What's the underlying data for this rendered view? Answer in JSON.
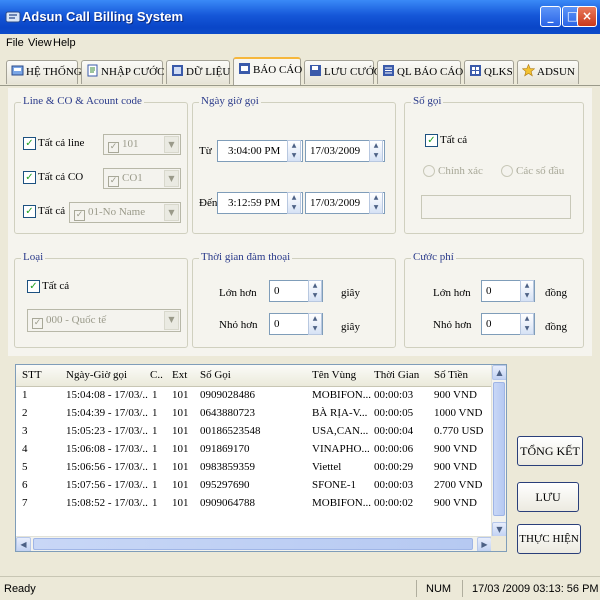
{
  "window": {
    "title": "Adsun Call Billing System"
  },
  "menu": {
    "file": "File",
    "view": "View",
    "help": "Help"
  },
  "tabs": [
    {
      "label": "HỆ THỐNG",
      "icon": "system-icon",
      "color": "#4a7ad8"
    },
    {
      "label": "NHẬP CƯỚC",
      "icon": "import-icon",
      "color": "#3a8a3a"
    },
    {
      "label": "DỮ LIỆU",
      "icon": "database-icon",
      "color": "#3a5aaa"
    },
    {
      "label": "BÁO CÁO",
      "icon": "report-icon",
      "color": "#3a5aaa"
    },
    {
      "label": "LƯU CƯỚC",
      "icon": "save-icon",
      "color": "#3a5aaa"
    },
    {
      "label": "QL BÁO CÁO",
      "icon": "report-manager-icon",
      "color": "#3a5aaa"
    },
    {
      "label": "QLKS",
      "icon": "hotel-icon",
      "color": "#3a5aaa"
    },
    {
      "label": "ADSUN",
      "icon": "adsun-star-icon",
      "color": "#e8b020"
    }
  ],
  "line_group": {
    "title": "Line & CO & Acount code",
    "all_line_label": "Tất cả line",
    "line_value": "101",
    "all_co_label": "Tất cả CO",
    "co_value": "CO1",
    "all_account_label": "Tất cả",
    "account_value": "01-No Name"
  },
  "datetime_group": {
    "title": "Ngày giờ gọi",
    "from_label": "Từ",
    "from_time": "3:04:00 PM",
    "from_date": "17/03/2009",
    "to_label": "Đến",
    "to_time": "3:12:59 PM",
    "to_date": "17/03/2009"
  },
  "number_group": {
    "title": "Số gọi",
    "all_label": "Tất cả",
    "exact_label": "Chính xác",
    "prefix_label": "Các số đầu",
    "value": ""
  },
  "type_group": {
    "title": "Loại",
    "all_label": "Tất cả",
    "type_value": "000 - Quốc tế"
  },
  "duration_group": {
    "title": "Thời gian đàm thoại",
    "greater_label": "Lớn hơn",
    "greater_value": "0",
    "less_label": "Nhỏ hơn",
    "less_value": "0",
    "unit": "giây"
  },
  "fee_group": {
    "title": "Cước phí",
    "greater_label": "Lớn hơn",
    "greater_value": "0",
    "less_label": "Nhỏ hơn",
    "less_value": "0",
    "unit": "đồng"
  },
  "table": {
    "columns": [
      "STT",
      "Ngày-Giờ gọi",
      "C..",
      "Ext",
      "Số Gọi",
      "Tên Vùng",
      "Thời Gian",
      "Số Tiền"
    ],
    "rows": [
      [
        "1",
        "15:04:08 - 17/03/...",
        "1",
        "101",
        "0909028486",
        "MOBIFON...",
        "00:00:03",
        "900 VND"
      ],
      [
        "2",
        "15:04:39 - 17/03/...",
        "1",
        "101",
        "0643880723",
        "BÀ RỊA-V...",
        "00:00:05",
        "1000 VND"
      ],
      [
        "3",
        "15:05:23 - 17/03/...",
        "1",
        "101",
        "00186523548",
        "USA,CAN...",
        "00:00:04",
        "0.770 USD"
      ],
      [
        "4",
        "15:06:08 - 17/03/...",
        "1",
        "101",
        "091869170",
        "VINAPHO...",
        "00:00:06",
        "900 VND"
      ],
      [
        "5",
        "15:06:56 - 17/03/...",
        "1",
        "101",
        "0983859359",
        "Viettel",
        "00:00:29",
        "900 VND"
      ],
      [
        "6",
        "15:07:56 - 17/03/...",
        "1",
        "101",
        "095297690",
        "SFONE-1",
        "00:00:03",
        "2700 VND"
      ],
      [
        "7",
        "15:08:52 - 17/03/...",
        "1",
        "101",
        "0909064788",
        "MOBIFON...",
        "00:00:02",
        "900 VND"
      ]
    ]
  },
  "buttons": {
    "summary": "TỔNG KẾT",
    "save": "LƯU",
    "execute": "THỰC HIỆN"
  },
  "status": {
    "text": "Ready",
    "num": "NUM",
    "datetime": "17/03 /2009   03:13: 56 PM"
  }
}
